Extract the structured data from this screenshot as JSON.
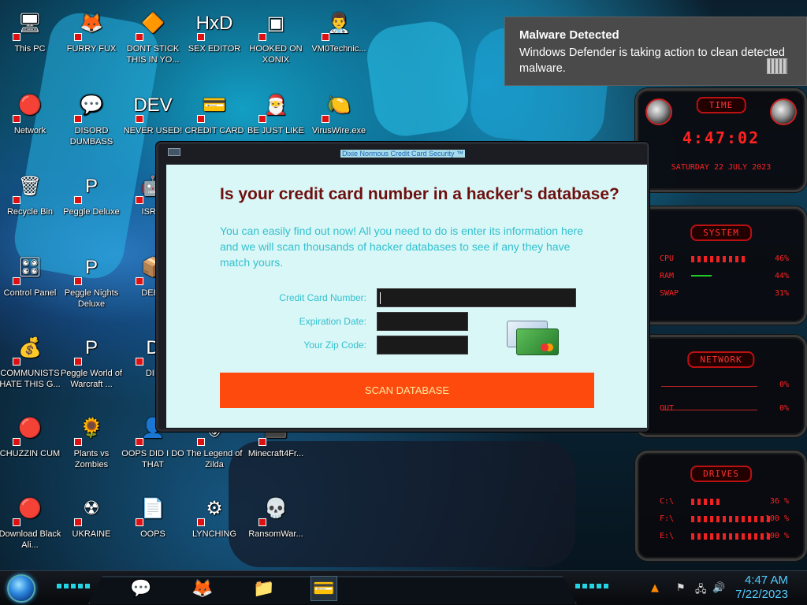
{
  "desktop": {
    "icons": [
      {
        "label": "This PC",
        "glyph": "🖥",
        "name": "this-pc"
      },
      {
        "label": "FURRY FUX",
        "glyph": "🦊",
        "name": "furry-fux"
      },
      {
        "label": "DONT STICK THIS IN YO...",
        "glyph": "🔶",
        "name": "dont-stick"
      },
      {
        "label": "SEX EDITOR",
        "glyph": "HxD",
        "name": "sex-editor"
      },
      {
        "label": "HOOKED ON XONIX",
        "glyph": "▣",
        "name": "hooked-on-xonix"
      },
      {
        "label": "VM0Technic...",
        "glyph": "👨‍⚕️",
        "name": "vm0technic"
      },
      {
        "label": "Network",
        "glyph": "🔴",
        "name": "network"
      },
      {
        "label": "DISORD DUMBASS",
        "glyph": "💬",
        "name": "disord-dumbass"
      },
      {
        "label": "NEVER USED!",
        "glyph": "DEV",
        "name": "never-used"
      },
      {
        "label": "CREDIT CARD",
        "glyph": "💳",
        "name": "credit-card"
      },
      {
        "label": "BE JUST LIKE",
        "glyph": "🎅",
        "name": "be-just-like"
      },
      {
        "label": "VirusWire.exe",
        "glyph": "🍋",
        "name": "viruswire"
      },
      {
        "label": "Recycle Bin",
        "glyph": "🗑",
        "name": "recycle-bin"
      },
      {
        "label": "Peggle Deluxe",
        "glyph": "P",
        "name": "peggle-deluxe"
      },
      {
        "label": "ISRAI",
        "glyph": "🤖",
        "name": "israi"
      },
      {
        "label": "Control Panel",
        "glyph": "🎛",
        "name": "control-panel"
      },
      {
        "label": "Peggle Nights Deluxe",
        "glyph": "P",
        "name": "peggle-nights"
      },
      {
        "label": "DEEZ",
        "glyph": "📦",
        "name": "deez"
      },
      {
        "label": "COMMUNISTS HATE THIS G...",
        "glyph": "💰",
        "name": "communists"
      },
      {
        "label": "Peggle World of Warcraft ...",
        "glyph": "P",
        "name": "peggle-wow"
      },
      {
        "label": "DIE",
        "glyph": "D",
        "name": "die"
      },
      {
        "label": "CHUZZIN CUM",
        "glyph": "🔴",
        "name": "chuzzin"
      },
      {
        "label": "Plants vs Zombies",
        "glyph": "🌻",
        "name": "pvz"
      },
      {
        "label": "OOPS DID I DO THAT",
        "glyph": "👤",
        "name": "oops-did"
      },
      {
        "label": "The Legend of Zilda",
        "glyph": "🛡",
        "name": "zilda"
      },
      {
        "label": "Minecraft4Fr...",
        "glyph": "⬛",
        "name": "minecraft"
      },
      {
        "label": "Download Black Ali...",
        "glyph": "🔴",
        "name": "black-ali"
      },
      {
        "label": "UKRAINE",
        "glyph": "☢",
        "name": "ukraine"
      },
      {
        "label": "OOPS",
        "glyph": "📄",
        "name": "oops"
      },
      {
        "label": "LYNCHING",
        "glyph": "⚙",
        "name": "lynching"
      },
      {
        "label": "RansomWar...",
        "glyph": "💀",
        "name": "ransomware"
      }
    ]
  },
  "toast": {
    "title": "Malware Detected",
    "message": "Windows Defender is taking action to clean detected malware."
  },
  "dialog": {
    "window_title": "Dixie Normous Credit Card Security ™",
    "heading": "Is your credit card number in a hacker's database?",
    "description": "You can easily find out now! All you need to do is enter its information here and we will scan thousands of hacker databases to see if any they have match yours.",
    "fields": {
      "card_label": "Credit Card Number:",
      "card_value": "",
      "exp_label": "Expiration Date:",
      "exp_value": "",
      "zip_label": "Your Zip Code:",
      "zip_value": ""
    },
    "scan_button": "SCAN DATABASE"
  },
  "hud": {
    "time_title": "TIME",
    "time_value": "4:47:02",
    "date_value": "SATURDAY 22 JULY 2023",
    "system_title": "SYSTEM",
    "system_rows": [
      {
        "label": "CPU",
        "pct": "46%"
      },
      {
        "label": "RAM",
        "pct": "44%"
      },
      {
        "label": "SWAP",
        "pct": "31%"
      }
    ],
    "network_title": "NETWORK",
    "network_rows": [
      {
        "label": "",
        "pct": "0%"
      },
      {
        "label": "OUT",
        "pct": "0%"
      }
    ],
    "drives_title": "DRIVES",
    "drive_rows": [
      {
        "label": "C:\\",
        "pct": "36 %"
      },
      {
        "label": "F:\\",
        "pct": "100 %"
      },
      {
        "label": "E:\\",
        "pct": "100 %"
      }
    ]
  },
  "taskbar": {
    "clock_time": "4:47 AM",
    "clock_date": "7/22/2023"
  }
}
